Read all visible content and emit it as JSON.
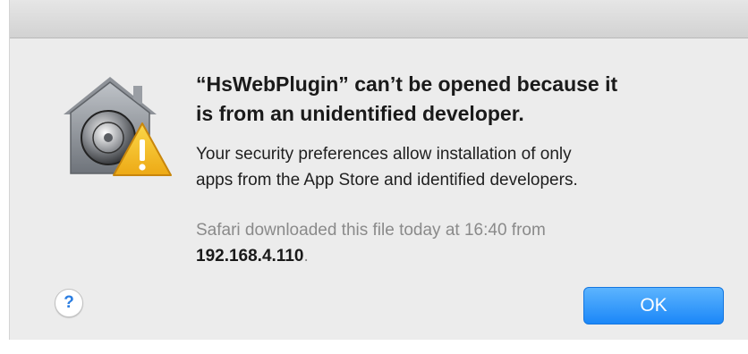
{
  "dialog": {
    "headline_line1": "“HsWebPlugin” can’t be opened because it",
    "headline_line2": "is from an unidentified developer.",
    "message_line1": "Your security preferences allow installation of only",
    "message_line2": "apps from the App Store and identified developers.",
    "source_line1": "Safari downloaded this file today at 16:40 from",
    "source_host": "192.168.4.110",
    "source_suffix": ".",
    "icon": "gatekeeper-house-warning-icon"
  },
  "buttons": {
    "help_label": "?",
    "ok_label": "OK"
  },
  "colors": {
    "window_bg": "#ececec",
    "ok_button": "#1b87f8",
    "warning_yellow": "#f5c518",
    "help_glyph": "#2a7de1"
  }
}
